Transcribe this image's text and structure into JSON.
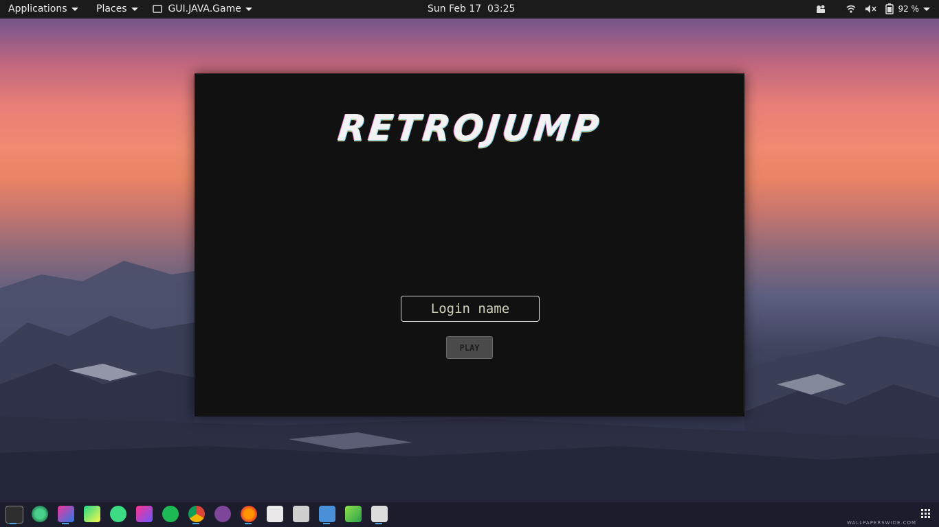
{
  "topbar": {
    "applications": "Applications",
    "places": "Places",
    "app_name": "GUI.JAVA.Game",
    "clock": "Sun Feb 17  03:25",
    "battery": "92 %"
  },
  "game": {
    "title": "RETROJUMP",
    "login_placeholder": "Login name",
    "play_label": "PLAY"
  },
  "dock": {
    "items": [
      "terminal-icon",
      "disk-usage-icon",
      "intellij-icon",
      "pycharm-icon",
      "android-studio-icon",
      "jetbrains-toolbox-icon",
      "spotify-icon",
      "chrome-icon",
      "tor-icon",
      "firefox-icon",
      "mail-icon",
      "dropbox-icon",
      "text-editor-icon",
      "sublime-icon",
      "files-icon"
    ]
  },
  "watermark": "WALLPAPERSWIDE.COM",
  "colors": {
    "topbar": "#1b1b1b",
    "game_bg": "#111111",
    "dock_indicator": "#4fa3e0"
  }
}
